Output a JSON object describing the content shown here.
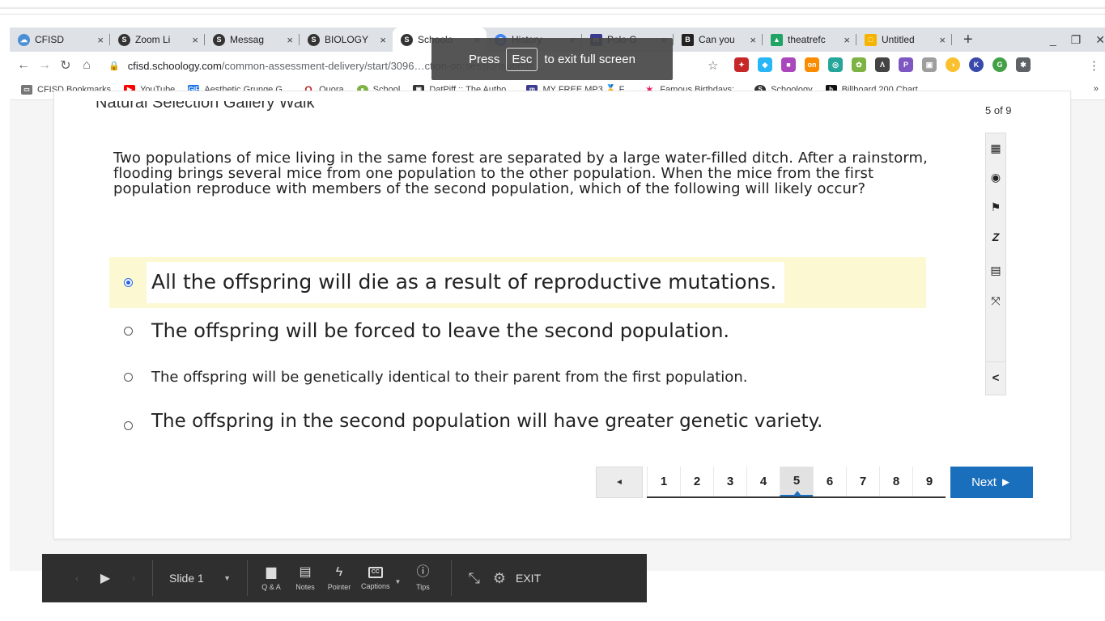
{
  "browser": {
    "tabs": [
      {
        "label": "CFISD",
        "color": "#4a8fd6",
        "glyph": "☁"
      },
      {
        "label": "Zoom Li",
        "color": "#333333",
        "glyph": "S"
      },
      {
        "label": "Messag",
        "color": "#333333",
        "glyph": "S"
      },
      {
        "label": "BIOLOGY",
        "color": "#333333",
        "glyph": "S"
      },
      {
        "label": "Schoolo",
        "color": "#333333",
        "glyph": "S"
      },
      {
        "label": "History",
        "color": "#4285f4",
        "glyph": "◷"
      },
      {
        "label": "Polo G",
        "color": "#3b3b8f",
        "glyph": "m"
      },
      {
        "label": "Can you",
        "color": "#222222",
        "glyph": "B"
      },
      {
        "label": "theatrefc",
        "color": "#1fa463",
        "glyph": "▲"
      },
      {
        "label": "Untitled",
        "color": "#f4b400",
        "glyph": "□"
      }
    ],
    "new_tab": "+",
    "url_host": "cfisd.schoology.com",
    "url_path": "/common-assessment-delivery/start/3096…ction-on:sessionsubmis…",
    "bookmarks": [
      {
        "label": "CFISD Bookmarks",
        "color": "#777777"
      },
      {
        "label": "YouTube",
        "color": "#ff0000"
      },
      {
        "label": "Aesthetic Grunge G...",
        "color": "#1a73e8"
      },
      {
        "label": "Quora",
        "color": "#b92b27"
      },
      {
        "label": "School",
        "color": "#7cb342"
      },
      {
        "label": "DatPiff :: The Autho...",
        "color": "#333333"
      },
      {
        "label": "MY FREE MP3 🏅 F...",
        "color": "#3b3b8f"
      },
      {
        "label": "Famous Birthdays:...",
        "color": "#e91e63"
      },
      {
        "label": "Schoology",
        "color": "#333333"
      },
      {
        "label": "Billboard 200 Chart...",
        "color": "#111111"
      }
    ],
    "bookmarks_more": "»",
    "toast": {
      "pre": "Press",
      "key": "Esc",
      "post": "to exit full screen"
    }
  },
  "quiz": {
    "title": "Natural Selection Gallery Walk",
    "counter": "5 of 9",
    "question": "Two populations of mice living in the same forest are separated by a large water-filled ditch. After a rainstorm, flooding brings several mice from one population to the other population. When the mice from the first population reproduce with members of the second population, which of the following will likely occur?",
    "options": [
      {
        "text": "All the offspring will die as a result of reproductive mutations.",
        "selected": true
      },
      {
        "text": "The offspring will be forced to leave the second population.",
        "selected": false
      },
      {
        "text": "The offspring will be genetically identical to their parent from the first population.",
        "selected": false
      },
      {
        "text": "The offspring in the second population will have greater genetic variety.",
        "selected": false
      }
    ],
    "pages": [
      "1",
      "2",
      "3",
      "4",
      "5",
      "6",
      "7",
      "8",
      "9"
    ],
    "current_page": "5",
    "prev_label": "◄",
    "next_label": "Next ►",
    "tools": [
      "calculator-icon",
      "accessibility-icon",
      "flag-icon",
      "eliminate-icon",
      "notepad-icon",
      "expand-icon"
    ],
    "collapse_label": "<"
  },
  "player": {
    "slide_label": "Slide 1",
    "buttons": [
      "Q & A",
      "Notes",
      "Pointer",
      "Captions",
      "Tips"
    ],
    "captions_glyph": "CC",
    "exit_label": "EXIT"
  }
}
